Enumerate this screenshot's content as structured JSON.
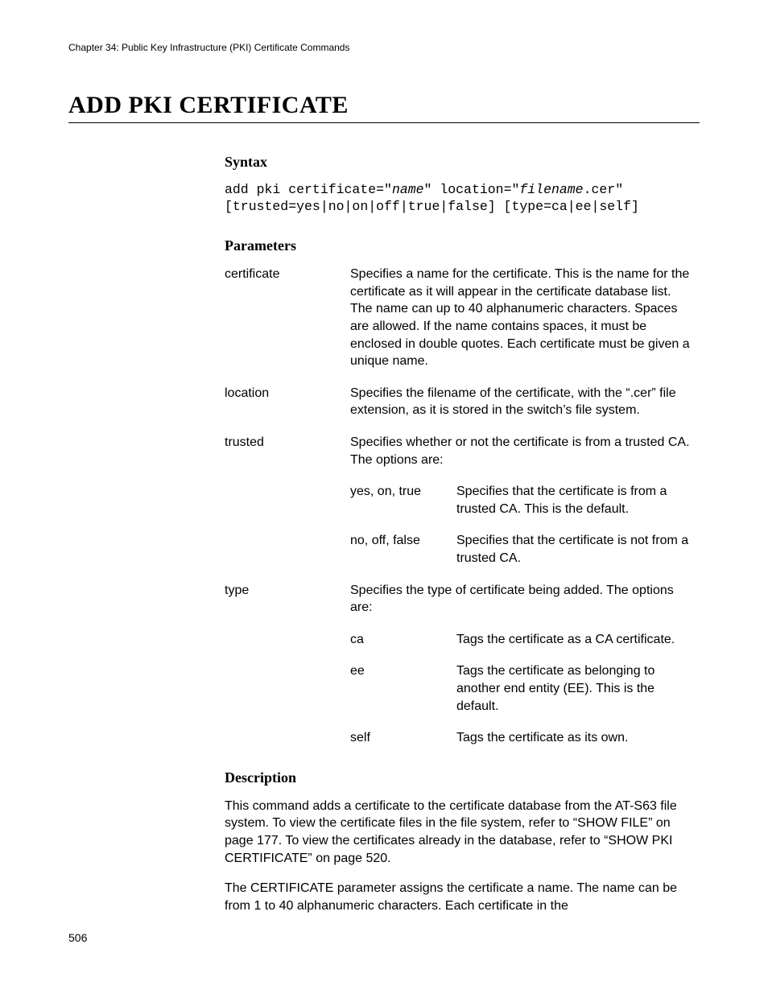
{
  "header": "Chapter 34: Public Key Infrastructure (PKI) Certificate Commands",
  "title": "ADD PKI CERTIFICATE",
  "syntax": {
    "heading": "Syntax",
    "pre1": "add pki certificate=\"",
    "name": "name",
    "mid1": "\" location=\"",
    "filename": "filename",
    "post1": ".cer\"",
    "line2": "[trusted=yes|no|on|off|true|false] [type=ca|ee|self]"
  },
  "parameters": {
    "heading": "Parameters",
    "rows": {
      "certificate": {
        "name": "certificate",
        "desc": "Specifies a name for the certificate. This is the name for the certificate as it will appear in the certificate database list. The name can up to 40 alphanumeric characters. Spaces are allowed. If the name contains spaces, it must be enclosed in double quotes. Each certificate must be given a unique name."
      },
      "location": {
        "name": "location",
        "desc": "Specifies the filename of the certificate, with the “.cer” file extension, as it is stored in the switch’s file system."
      },
      "trusted": {
        "name": "trusted",
        "desc": "Specifies whether or not the certificate is from a trusted CA. The options are:"
      },
      "type": {
        "name": "type",
        "desc": "Specifies the type of certificate being added. The options are:"
      }
    },
    "trusted_options": {
      "yes": {
        "name": "yes, on, true",
        "desc": "Specifies that the certificate is from a trusted CA. This is the default."
      },
      "no": {
        "name": "no, off, false",
        "desc": "Specifies that the certificate is not from a trusted CA."
      }
    },
    "type_options": {
      "ca": {
        "name": "ca",
        "desc": "Tags the certificate as a CA certificate."
      },
      "ee": {
        "name": "ee",
        "desc": "Tags the certificate as belonging to another end entity (EE). This is the default."
      },
      "self": {
        "name": "self",
        "desc": "Tags the certificate as its own."
      }
    }
  },
  "description": {
    "heading": "Description",
    "p1": "This command adds a certificate to the certificate database from the AT-S63 file system. To view the certificate files in the file system, refer to “SHOW FILE” on page 177. To view the certificates already in the database, refer to “SHOW PKI CERTIFICATE” on page 520.",
    "p2": "The CERTIFICATE parameter assigns the certificate a name. The name can be from 1 to 40 alphanumeric characters. Each certificate in the"
  },
  "page_number": "506"
}
